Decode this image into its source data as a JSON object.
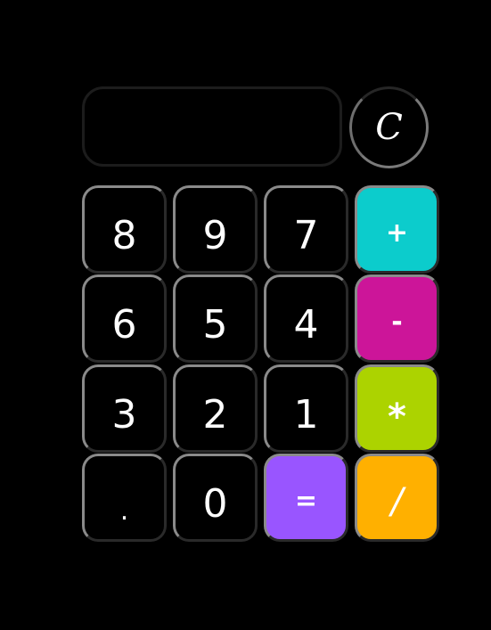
{
  "display": {
    "value": ""
  },
  "clear_label": "C",
  "keys": [
    {
      "label": "8"
    },
    {
      "label": "9"
    },
    {
      "label": "7"
    },
    {
      "label": "+"
    },
    {
      "label": "6"
    },
    {
      "label": "5"
    },
    {
      "label": "4"
    },
    {
      "label": "-"
    },
    {
      "label": "3"
    },
    {
      "label": "2"
    },
    {
      "label": "1"
    },
    {
      "label": "*"
    },
    {
      "label": "."
    },
    {
      "label": "0"
    },
    {
      "label": "="
    },
    {
      "label": "/"
    }
  ],
  "colors": {
    "background": "#000000",
    "plus": "#0ccccc",
    "minus": "#cc1599",
    "multiply": "#acd300",
    "equals": "#9955ff",
    "divide": "#ffb000"
  }
}
